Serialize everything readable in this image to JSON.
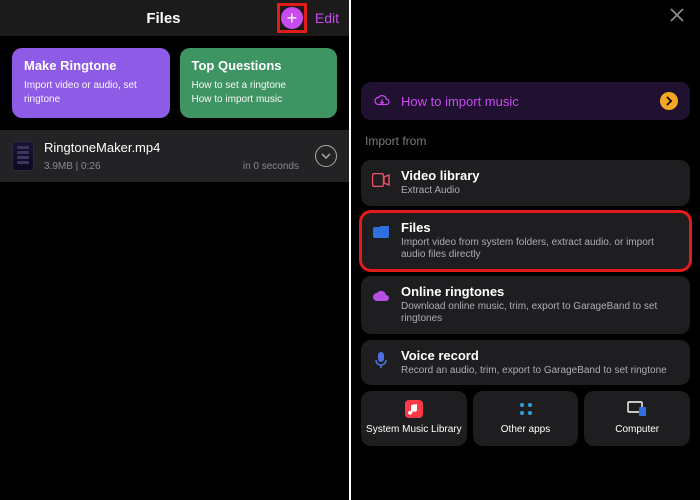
{
  "left": {
    "title": "Files",
    "edit": "Edit",
    "card_make": {
      "title": "Make Ringtone",
      "sub": "Import video or audio, set ringtone"
    },
    "card_top": {
      "title": "Top Questions",
      "sub": "How to set a ringtone\nHow to import music"
    },
    "file": {
      "name": "RingtoneMaker.mp4",
      "meta": "3.9MB | 0:26",
      "age": "in 0 seconds"
    }
  },
  "right": {
    "banner": "How to import music",
    "section": "Import from",
    "opts": [
      {
        "title": "Video library",
        "desc": "Extract Audio"
      },
      {
        "title": "Files",
        "desc": "Import video from system folders, extract audio. or import audio files directly"
      },
      {
        "title": "Online ringtones",
        "desc": "Download online music, trim, export to GarageBand to set ringtones"
      },
      {
        "title": "Voice record",
        "desc": "Record an audio, trim, export to GarageBand to set ringtone"
      }
    ],
    "grid": [
      {
        "label": "System Music Library"
      },
      {
        "label": "Other apps"
      },
      {
        "label": "Computer"
      }
    ]
  }
}
